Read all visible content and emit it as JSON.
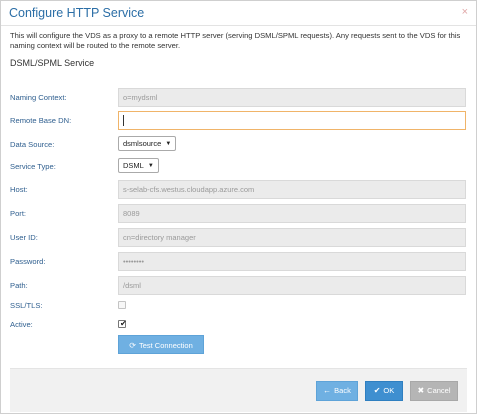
{
  "dialog": {
    "title": "Configure HTTP Service",
    "close_glyph": "×",
    "intro": "This will configure the VDS as a proxy to a remote HTTP server (serving DSML/SPML requests). Any requests sent to the VDS for this naming context will be routed to the remote server.",
    "section_title": "DSML/SPML Service"
  },
  "form": {
    "naming_context": {
      "label": "Naming Context:",
      "value": "o=mydsml"
    },
    "remote_base_dn": {
      "label": "Remote Base DN:",
      "value": ""
    },
    "data_source": {
      "label": "Data Source:",
      "value": "dsmlsource"
    },
    "service_type": {
      "label": "Service Type:",
      "value": "DSML"
    },
    "host": {
      "label": "Host:",
      "value": "s-selab-cfs.westus.cloudapp.azure.com"
    },
    "port": {
      "label": "Port:",
      "value": "8089"
    },
    "user_id": {
      "label": "User ID:",
      "value": "cn=directory manager"
    },
    "password": {
      "label": "Password:",
      "value": "••••••••"
    },
    "path": {
      "label": "Path:",
      "value": "/dsml"
    },
    "ssl_tls": {
      "label": "SSL/TLS:",
      "checked": false
    },
    "active": {
      "label": "Active:",
      "checked": true,
      "glyph": "✔"
    }
  },
  "buttons": {
    "test_connection": {
      "label": "Test Connection",
      "icon": "refresh-icon",
      "glyph": "⟳"
    },
    "back": {
      "label": "Back",
      "icon": "arrow-left-icon",
      "glyph": "←"
    },
    "ok": {
      "label": "OK",
      "icon": "check-icon",
      "glyph": "✔"
    },
    "cancel": {
      "label": "Cancel",
      "icon": "close-icon",
      "glyph": "✖"
    }
  },
  "colors": {
    "accent": "#2b6ea6",
    "label": "#2f5f8f",
    "button_primary": "#6fb0e2",
    "button_ok": "#3f8fd0",
    "button_disabled": "#b5b5b5",
    "focus_border": "#f0b469"
  }
}
